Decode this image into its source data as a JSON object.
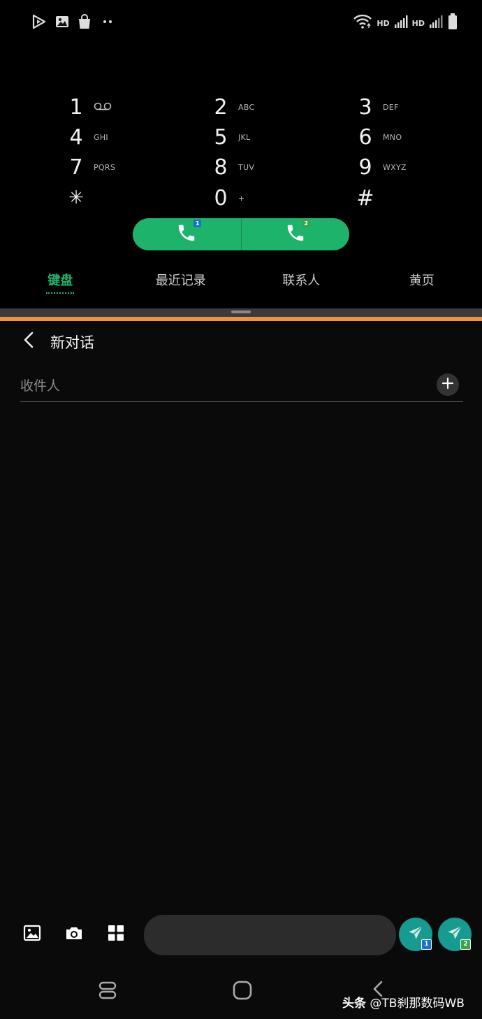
{
  "status_bar": {
    "left_icons": [
      "play-store-icon",
      "gallery-icon",
      "shopping-bag-icon",
      "more-dots-icon"
    ],
    "hd_label_1": "HD",
    "hd_label_2": "HD",
    "right_icons": [
      "wifi-icon",
      "signal-icon",
      "signal-icon",
      "battery-icon"
    ]
  },
  "dialer": {
    "keys": [
      {
        "num": "1",
        "sub": ""
      },
      {
        "num": "2",
        "sub": "ABC"
      },
      {
        "num": "3",
        "sub": "DEF"
      },
      {
        "num": "4",
        "sub": "GHI"
      },
      {
        "num": "5",
        "sub": "JKL"
      },
      {
        "num": "6",
        "sub": "MNO"
      },
      {
        "num": "7",
        "sub": "PQRS"
      },
      {
        "num": "8",
        "sub": "TUV"
      },
      {
        "num": "9",
        "sub": "WXYZ"
      },
      {
        "num": "✳",
        "sub": ""
      },
      {
        "num": "0",
        "sub": "+"
      },
      {
        "num": "#",
        "sub": ""
      }
    ],
    "call_sim1_badge": "1",
    "call_sim2_badge": "2",
    "tabs": [
      {
        "label": "键盘",
        "active": true
      },
      {
        "label": "最近记录",
        "active": false
      },
      {
        "label": "联系人",
        "active": false
      },
      {
        "label": "黄页",
        "active": false
      }
    ]
  },
  "colors": {
    "call_green": "#1db36a",
    "split_accent": "#f0923a",
    "send_teal": "#179a8f",
    "sim1_blue": "#1a73c9",
    "sim2_green": "#3aa34a"
  },
  "conversation": {
    "title": "新对话",
    "recipient_placeholder": "收件人",
    "send_sim1_badge": "1",
    "send_sim2_badge": "2"
  },
  "watermark": {
    "prefix": "头条",
    "handle": "@TB刹那数码WB"
  }
}
